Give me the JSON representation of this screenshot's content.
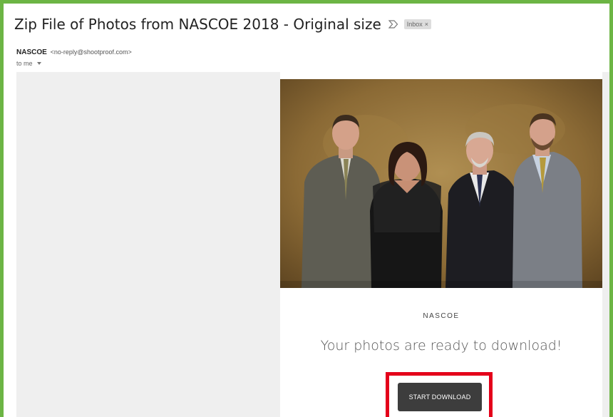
{
  "email": {
    "subject": "Zip File of Photos from NASCOE 2018 - Original size",
    "label": "Inbox",
    "label_close": "×",
    "sender_name": "NASCOE",
    "sender_email": "<no-reply@shootproof.com>",
    "recipient": "to me"
  },
  "card": {
    "brand": "NASCOE",
    "headline": "Your photos are ready to download!",
    "button_label": "START DOWNLOAD"
  },
  "colors": {
    "frame_border": "#6cb544",
    "highlight_border": "#e4001a",
    "button_bg": "#3d3d3d",
    "body_bg": "#efefef"
  },
  "icons": [
    "important-marker-icon",
    "chevron-down-icon"
  ]
}
